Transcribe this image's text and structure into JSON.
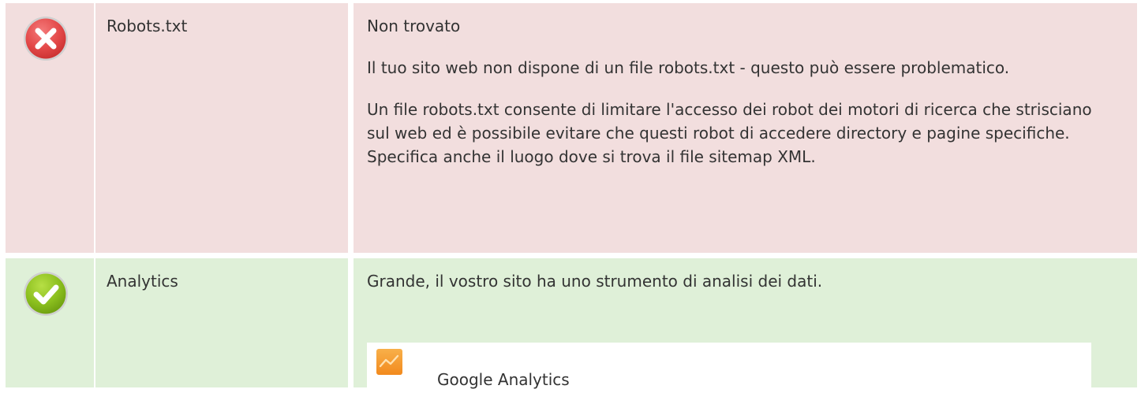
{
  "checks": {
    "robots": {
      "status": "error",
      "status_icon": "error-x-icon",
      "name": "Robots.txt",
      "paragraphs": [
        "Non trovato",
        "Il tuo sito web non dispone di un file robots.txt - questo può essere problematico.",
        "Un file robots.txt consente di limitare l'accesso dei robot dei motori di ricerca che strisciano sul web ed è possibile evitare che questi robot di accedere directory e pagine specifiche. Specifica anche il luogo dove si trova il file sitemap XML."
      ]
    },
    "analytics": {
      "status": "success",
      "status_icon": "success-check-icon",
      "name": "Analytics",
      "message": "Grande, il vostro sito ha uno strumento di analisi dei dati.",
      "tools": [
        {
          "name": "Google Analytics",
          "icon": "google-analytics-icon"
        }
      ]
    }
  },
  "colors": {
    "error_bg": "#f2dede",
    "success_bg": "#dff0d8",
    "error_icon": "#e04444",
    "success_icon": "#8bbf1e",
    "ga_orange": "#f6a13a"
  }
}
